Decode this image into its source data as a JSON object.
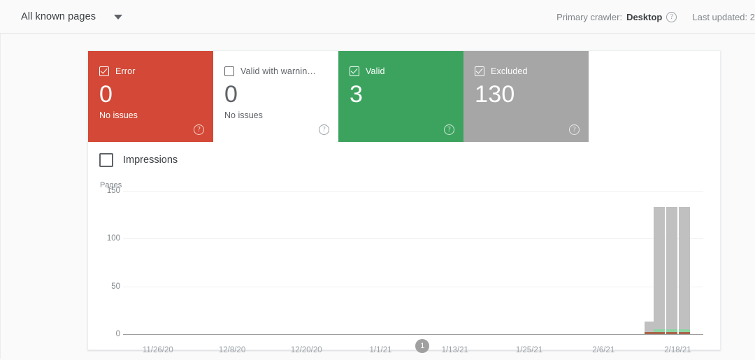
{
  "header": {
    "page_filter": "All known pages",
    "caret_icon": "chevron-down-icon",
    "crawler_prefix": "Primary crawler:",
    "crawler_value": "Desktop",
    "help_icon": "help-circle-icon",
    "last_updated": "Last updated: 2"
  },
  "tiles": [
    {
      "title": "Error",
      "count": "0",
      "subtitle": "No issues",
      "checked": true,
      "color": "#d34836",
      "help_icon": "help-circle-icon"
    },
    {
      "title": "Valid with warnin…",
      "count": "0",
      "subtitle": "No issues",
      "checked": false,
      "color": "#ffffff",
      "help_icon": "help-circle-icon"
    },
    {
      "title": "Valid",
      "count": "3",
      "subtitle": "",
      "checked": true,
      "color": "#3ca35f",
      "help_icon": "help-circle-icon"
    },
    {
      "title": "Excluded",
      "count": "130",
      "subtitle": "",
      "checked": true,
      "color": "#a6a6a6",
      "help_icon": "help-circle-icon"
    }
  ],
  "impressions": {
    "label": "Impressions",
    "checked": false
  },
  "chart_data": {
    "type": "bar",
    "title": "",
    "ylabel": "Pages",
    "xlabel": "",
    "ylim": [
      0,
      150
    ],
    "yticks": [
      "150",
      "100",
      "50",
      "0"
    ],
    "ytick_values": [
      150,
      100,
      50,
      0
    ],
    "grid": true,
    "legend": "none",
    "xtick_labels": [
      "11/26/20",
      "12/8/20",
      "12/20/20",
      "1/1/21",
      "1/13/21",
      "1/25/21",
      "2/6/21",
      "2/18/21"
    ],
    "stacked": true,
    "series": [
      {
        "name": "Excluded",
        "color": "#c0c0c0",
        "values": [
          0,
          0,
          0,
          0,
          11,
          128,
          128,
          128
        ]
      },
      {
        "name": "Valid",
        "color": "#8fd4a4",
        "values": [
          0,
          0,
          0,
          0,
          3,
          3,
          3,
          3
        ]
      },
      {
        "name": "Error",
        "color": "#a8644a",
        "values": [
          0,
          0,
          0,
          0,
          2,
          2,
          2,
          2
        ]
      }
    ],
    "bars": [
      {
        "x_pct": 90.8,
        "total": 13,
        "excluded": 11,
        "valid": 0,
        "error": 2
      },
      {
        "x_pct": 92.4,
        "total": 133,
        "excluded": 128,
        "valid": 3,
        "error": 2
      },
      {
        "x_pct": 94.6,
        "total": 133,
        "excluded": 128,
        "valid": 3,
        "error": 2
      },
      {
        "x_pct": 96.8,
        "total": 133,
        "excluded": 128,
        "valid": 3,
        "error": 2
      }
    ],
    "annotations": [
      {
        "label": "1",
        "x_pct": 51.6
      }
    ]
  }
}
